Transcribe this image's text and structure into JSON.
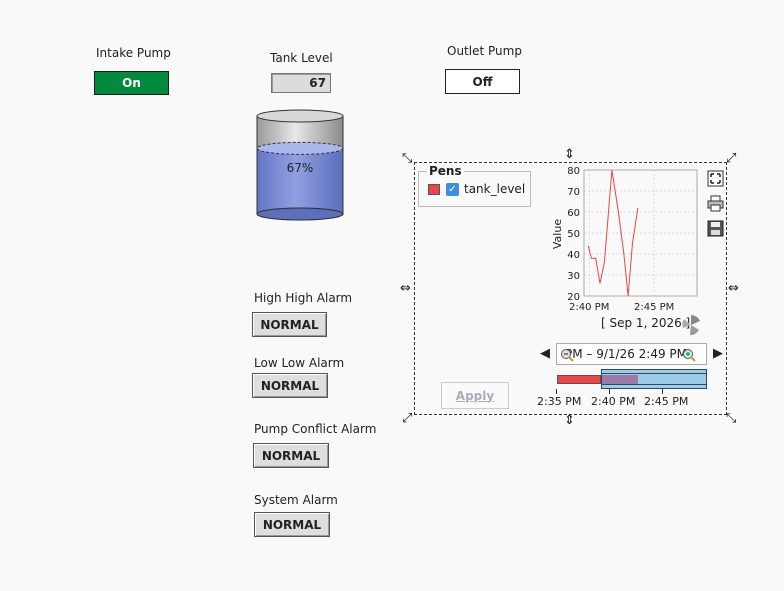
{
  "intake_pump": {
    "label": "Intake Pump",
    "state": "On"
  },
  "tank_level": {
    "label": "Tank Level",
    "value": "67",
    "percent_text": "67%",
    "level_fraction": 0.67
  },
  "outlet_pump": {
    "label": "Outlet Pump",
    "state": "Off"
  },
  "alarms": [
    {
      "label": "High High Alarm",
      "status": "NORMAL"
    },
    {
      "label": "Low Low Alarm",
      "status": "NORMAL"
    },
    {
      "label": "Pump Conflict Alarm",
      "status": "NORMAL"
    },
    {
      "label": "System Alarm",
      "status": "NORMAL"
    }
  ],
  "colors": {
    "on_green": "#008a3e",
    "tank_liquid": "#7d8fd6",
    "pen_red": "#e8464a",
    "checkbox_blue": "#3d8ee0"
  },
  "chart": {
    "pens_title": "Pens",
    "pens": [
      {
        "name": "tank_level",
        "checked": true,
        "color": "#e8464a"
      }
    ],
    "ylabel": "Value",
    "date_label": "[ Sep 1, 2026 ]",
    "range_text": "PM – 9/1/26 2:49 PM",
    "apply_label": "Apply",
    "range_axis": [
      "2:35 PM",
      "2:40 PM",
      "2:45 PM"
    ]
  },
  "chart_data": {
    "type": "line",
    "xlabel": "",
    "ylabel": "Value",
    "ylim": [
      20,
      80
    ],
    "y_ticks": [
      20,
      30,
      40,
      50,
      60,
      70,
      80
    ],
    "x_ticks": [
      "2:40 PM",
      "2:45 PM"
    ],
    "grid": true,
    "series": [
      {
        "name": "tank_level",
        "x": [
          "2:39:55 PM",
          "2:40:10 PM",
          "2:40:30 PM",
          "2:40:50 PM",
          "2:41:10 PM",
          "2:41:45 PM",
          "2:42:15 PM",
          "2:42:40 PM",
          "2:43:00 PM",
          "2:43:20 PM",
          "2:43:45 PM"
        ],
        "x_minutes": [
          39.92,
          40.17,
          40.5,
          40.83,
          41.17,
          41.75,
          42.25,
          42.67,
          43.0,
          43.33,
          43.75
        ],
        "values": [
          44,
          38,
          38,
          26,
          36,
          80,
          60,
          40,
          20,
          45,
          62
        ]
      }
    ]
  }
}
